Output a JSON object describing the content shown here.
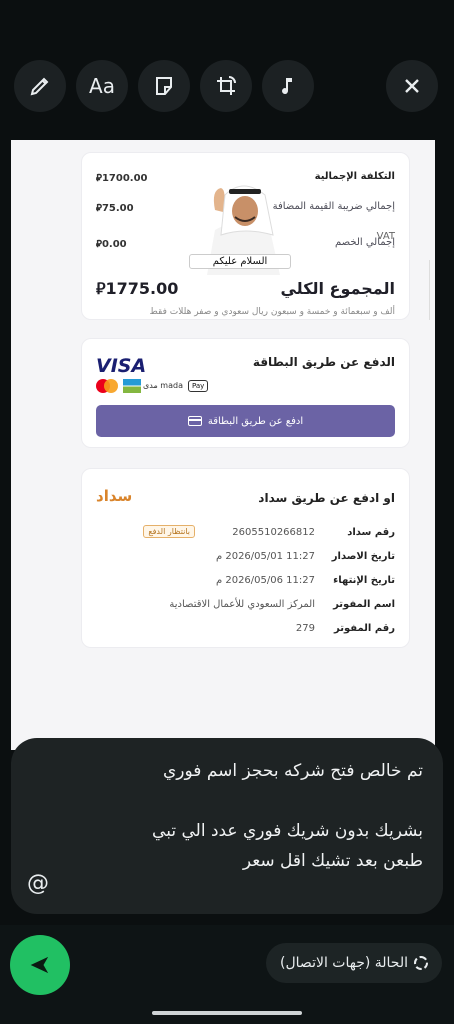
{
  "toolbar": {
    "text_label": "Aa",
    "icons": [
      "pencil-icon",
      "text-icon",
      "sticker-icon",
      "crop-rotate-icon",
      "music-icon",
      "close-icon"
    ]
  },
  "invoice": {
    "total_cost_label": "التكلفة الإجمالية",
    "total_cost_value": "1700.00",
    "vat_label": "إجمالي ضريبة القيمة المضافة",
    "vat_value": "75.00",
    "vat_suffix": "VAT",
    "discount_label": "إجمالي الخصم",
    "discount_value": "0.00",
    "grand_total_label": "المجموع الكلي",
    "grand_total_value": "1775.00",
    "amount_words": "ألف و سبعمائة و خمسة و سبعون ريال سعودي و صفر هللات فقط",
    "currency_symbol": "⃁"
  },
  "card_payment": {
    "title": "الدفع عن طريق البطاقة",
    "visa": "VISA",
    "mada": "مدى mada",
    "apple_pay": "Pay",
    "pay_button": "ادفع عن طريق البطاقة"
  },
  "sticker": {
    "caption": "السلام عليكم"
  },
  "sadad": {
    "title": "او ادفع عن طريق سداد",
    "logo": "سداد",
    "status_badge": "بانتظار الدفع",
    "fields": [
      {
        "key": "رقم سداد",
        "value": "2605510266812"
      },
      {
        "key": "تاريخ الاصدار",
        "value": "11:27 2026/05/01 م"
      },
      {
        "key": "تاريخ الإنتهاء",
        "value": "11:27 2026/05/06 م"
      },
      {
        "key": "اسم المفوتر",
        "value": "المركز السعودي للأعمال الاقتصادية"
      },
      {
        "key": "رقم المفوتر",
        "value": "279"
      }
    ]
  },
  "caption": {
    "line1": "تم خالص فتح شركه بحجز اسم فوري",
    "line2": "بشريك بدون شريك فوري عدد الي تبي",
    "line3": "طبعن بعد تشيك اقل سعر",
    "mention_symbol": "@"
  },
  "footer": {
    "status_label": "الحالة (جهات الاتصال)"
  }
}
